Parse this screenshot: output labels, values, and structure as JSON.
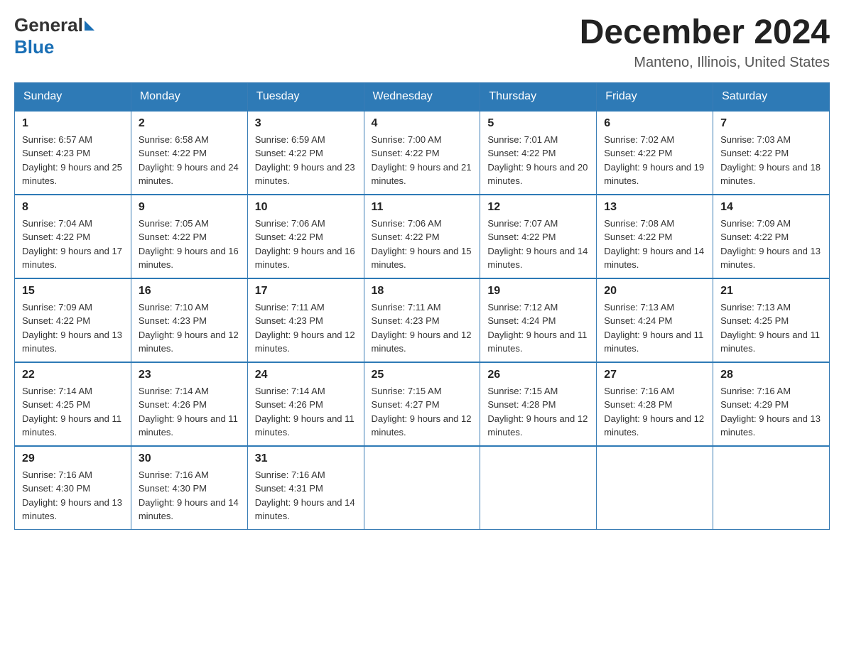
{
  "header": {
    "month_title": "December 2024",
    "location": "Manteno, Illinois, United States",
    "logo_general": "General",
    "logo_blue": "Blue"
  },
  "weekdays": [
    "Sunday",
    "Monday",
    "Tuesday",
    "Wednesday",
    "Thursday",
    "Friday",
    "Saturday"
  ],
  "weeks": [
    [
      {
        "day": "1",
        "sunrise": "6:57 AM",
        "sunset": "4:23 PM",
        "daylight": "9 hours and 25 minutes."
      },
      {
        "day": "2",
        "sunrise": "6:58 AM",
        "sunset": "4:22 PM",
        "daylight": "9 hours and 24 minutes."
      },
      {
        "day": "3",
        "sunrise": "6:59 AM",
        "sunset": "4:22 PM",
        "daylight": "9 hours and 23 minutes."
      },
      {
        "day": "4",
        "sunrise": "7:00 AM",
        "sunset": "4:22 PM",
        "daylight": "9 hours and 21 minutes."
      },
      {
        "day": "5",
        "sunrise": "7:01 AM",
        "sunset": "4:22 PM",
        "daylight": "9 hours and 20 minutes."
      },
      {
        "day": "6",
        "sunrise": "7:02 AM",
        "sunset": "4:22 PM",
        "daylight": "9 hours and 19 minutes."
      },
      {
        "day": "7",
        "sunrise": "7:03 AM",
        "sunset": "4:22 PM",
        "daylight": "9 hours and 18 minutes."
      }
    ],
    [
      {
        "day": "8",
        "sunrise": "7:04 AM",
        "sunset": "4:22 PM",
        "daylight": "9 hours and 17 minutes."
      },
      {
        "day": "9",
        "sunrise": "7:05 AM",
        "sunset": "4:22 PM",
        "daylight": "9 hours and 16 minutes."
      },
      {
        "day": "10",
        "sunrise": "7:06 AM",
        "sunset": "4:22 PM",
        "daylight": "9 hours and 16 minutes."
      },
      {
        "day": "11",
        "sunrise": "7:06 AM",
        "sunset": "4:22 PM",
        "daylight": "9 hours and 15 minutes."
      },
      {
        "day": "12",
        "sunrise": "7:07 AM",
        "sunset": "4:22 PM",
        "daylight": "9 hours and 14 minutes."
      },
      {
        "day": "13",
        "sunrise": "7:08 AM",
        "sunset": "4:22 PM",
        "daylight": "9 hours and 14 minutes."
      },
      {
        "day": "14",
        "sunrise": "7:09 AM",
        "sunset": "4:22 PM",
        "daylight": "9 hours and 13 minutes."
      }
    ],
    [
      {
        "day": "15",
        "sunrise": "7:09 AM",
        "sunset": "4:22 PM",
        "daylight": "9 hours and 13 minutes."
      },
      {
        "day": "16",
        "sunrise": "7:10 AM",
        "sunset": "4:23 PM",
        "daylight": "9 hours and 12 minutes."
      },
      {
        "day": "17",
        "sunrise": "7:11 AM",
        "sunset": "4:23 PM",
        "daylight": "9 hours and 12 minutes."
      },
      {
        "day": "18",
        "sunrise": "7:11 AM",
        "sunset": "4:23 PM",
        "daylight": "9 hours and 12 minutes."
      },
      {
        "day": "19",
        "sunrise": "7:12 AM",
        "sunset": "4:24 PM",
        "daylight": "9 hours and 11 minutes."
      },
      {
        "day": "20",
        "sunrise": "7:13 AM",
        "sunset": "4:24 PM",
        "daylight": "9 hours and 11 minutes."
      },
      {
        "day": "21",
        "sunrise": "7:13 AM",
        "sunset": "4:25 PM",
        "daylight": "9 hours and 11 minutes."
      }
    ],
    [
      {
        "day": "22",
        "sunrise": "7:14 AM",
        "sunset": "4:25 PM",
        "daylight": "9 hours and 11 minutes."
      },
      {
        "day": "23",
        "sunrise": "7:14 AM",
        "sunset": "4:26 PM",
        "daylight": "9 hours and 11 minutes."
      },
      {
        "day": "24",
        "sunrise": "7:14 AM",
        "sunset": "4:26 PM",
        "daylight": "9 hours and 11 minutes."
      },
      {
        "day": "25",
        "sunrise": "7:15 AM",
        "sunset": "4:27 PM",
        "daylight": "9 hours and 12 minutes."
      },
      {
        "day": "26",
        "sunrise": "7:15 AM",
        "sunset": "4:28 PM",
        "daylight": "9 hours and 12 minutes."
      },
      {
        "day": "27",
        "sunrise": "7:16 AM",
        "sunset": "4:28 PM",
        "daylight": "9 hours and 12 minutes."
      },
      {
        "day": "28",
        "sunrise": "7:16 AM",
        "sunset": "4:29 PM",
        "daylight": "9 hours and 13 minutes."
      }
    ],
    [
      {
        "day": "29",
        "sunrise": "7:16 AM",
        "sunset": "4:30 PM",
        "daylight": "9 hours and 13 minutes."
      },
      {
        "day": "30",
        "sunrise": "7:16 AM",
        "sunset": "4:30 PM",
        "daylight": "9 hours and 14 minutes."
      },
      {
        "day": "31",
        "sunrise": "7:16 AM",
        "sunset": "4:31 PM",
        "daylight": "9 hours and 14 minutes."
      },
      null,
      null,
      null,
      null
    ]
  ]
}
